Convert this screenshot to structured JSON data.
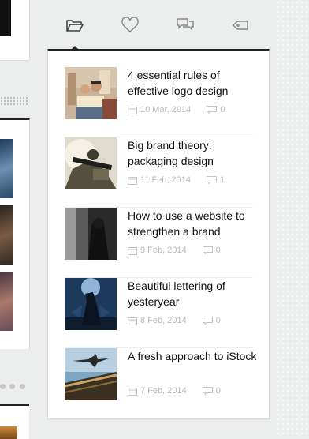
{
  "tabs": [
    {
      "name": "recent",
      "icon": "folder-icon",
      "active": true
    },
    {
      "name": "popular",
      "icon": "heart-icon",
      "active": false
    },
    {
      "name": "comments",
      "icon": "chat-icon",
      "active": false
    },
    {
      "name": "tags",
      "icon": "tag-icon",
      "active": false
    }
  ],
  "posts": [
    {
      "title": "4 essential rules of effective logo design",
      "date": "10 Mar, 2014",
      "comments": "0",
      "thumb_icon": "travelers-photo-icon"
    },
    {
      "title": "Big brand theory: packaging design",
      "date": "11 Feb, 2014",
      "comments": "1",
      "thumb_icon": "soldier-photo-icon"
    },
    {
      "title": "How to use a website to strengthen a brand",
      "date": "9 Feb, 2014",
      "comments": "0",
      "thumb_icon": "hooded-figure-photo-icon"
    },
    {
      "title": "Beautiful lettering of yesteryear",
      "date": "8 Feb, 2014",
      "comments": "0",
      "thumb_icon": "warrior-photo-icon"
    },
    {
      "title": "A fresh approach to iStock",
      "date": "7 Feb, 2014",
      "comments": "0",
      "thumb_icon": "airplane-photo-icon"
    }
  ],
  "colors": {
    "accent": "#222222",
    "meta": "#b8b8b8",
    "icon": "#777777"
  }
}
